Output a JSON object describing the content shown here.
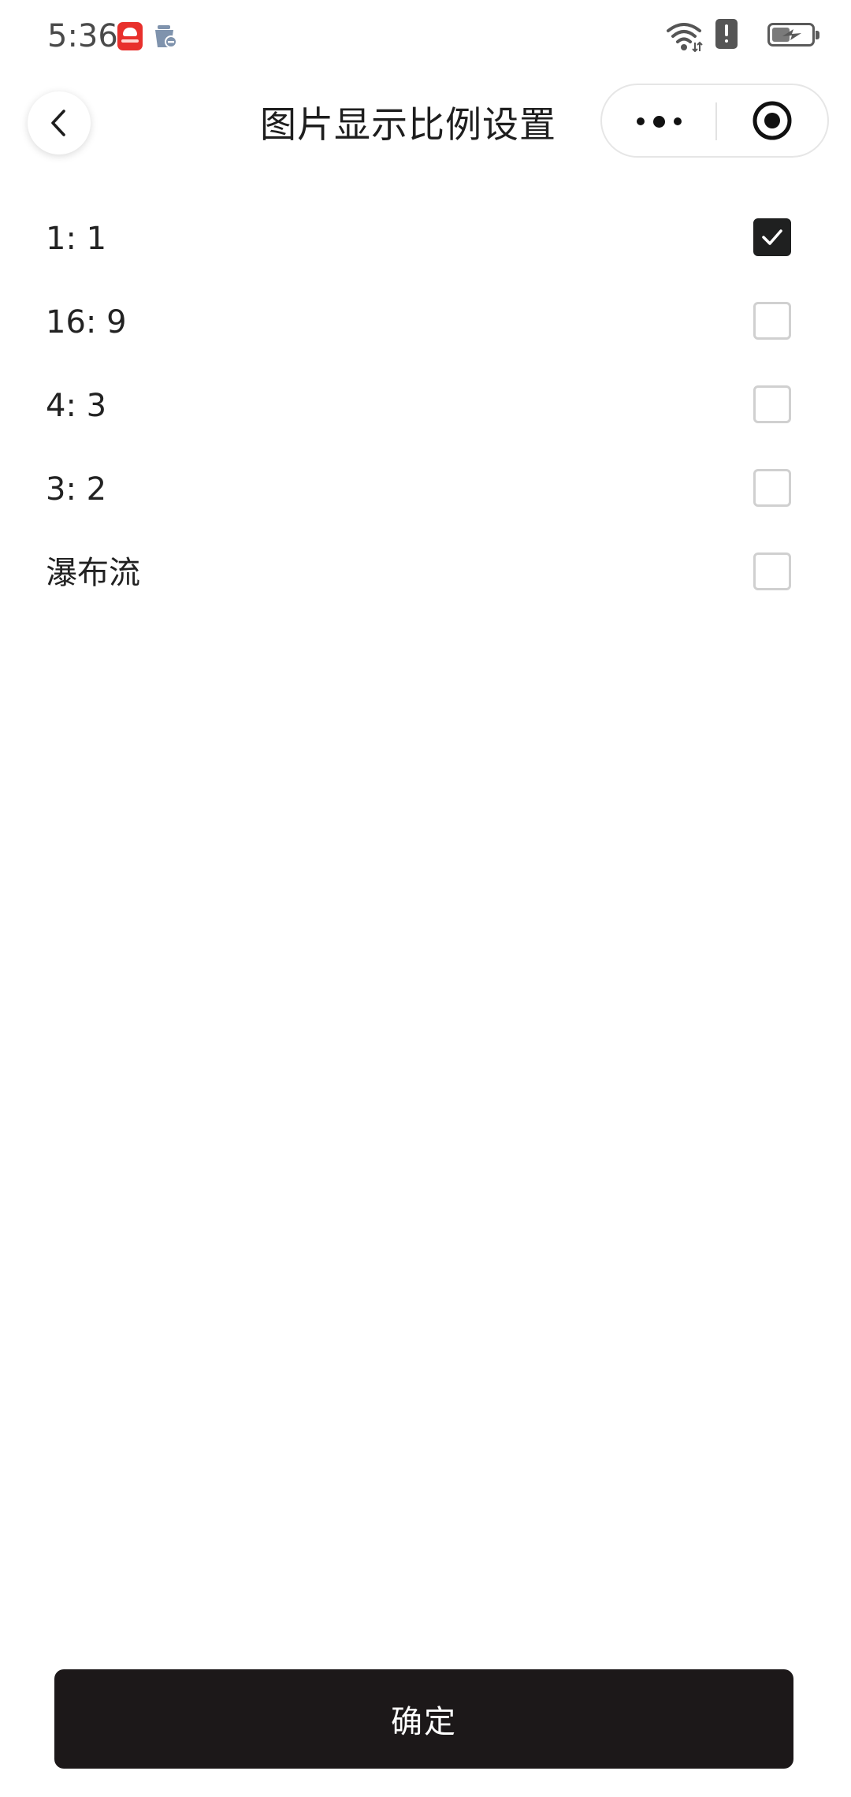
{
  "status_bar": {
    "time": "5:36",
    "icons": [
      "app-notification-icon",
      "cleaner-icon",
      "wifi-icon",
      "alert-icon",
      "battery-charging-icon"
    ]
  },
  "nav": {
    "title": "图片显示比例设置",
    "back_icon": "chevron-left-icon",
    "more_icon": "more-dots-icon",
    "close_icon": "target-circle-icon"
  },
  "options": [
    {
      "label": "1: 1",
      "checked": true
    },
    {
      "label": "16: 9",
      "checked": false
    },
    {
      "label": "4: 3",
      "checked": false
    },
    {
      "label": "3: 2",
      "checked": false
    },
    {
      "label": "瀑布流",
      "checked": false
    }
  ],
  "confirm_button": {
    "label": "确定"
  },
  "colors": {
    "accent": "#1c1819",
    "checkbox_checked": "#1f2020",
    "checkbox_border": "#d0d0d0",
    "text": "#1e1e1e",
    "background": "#ffffff"
  }
}
